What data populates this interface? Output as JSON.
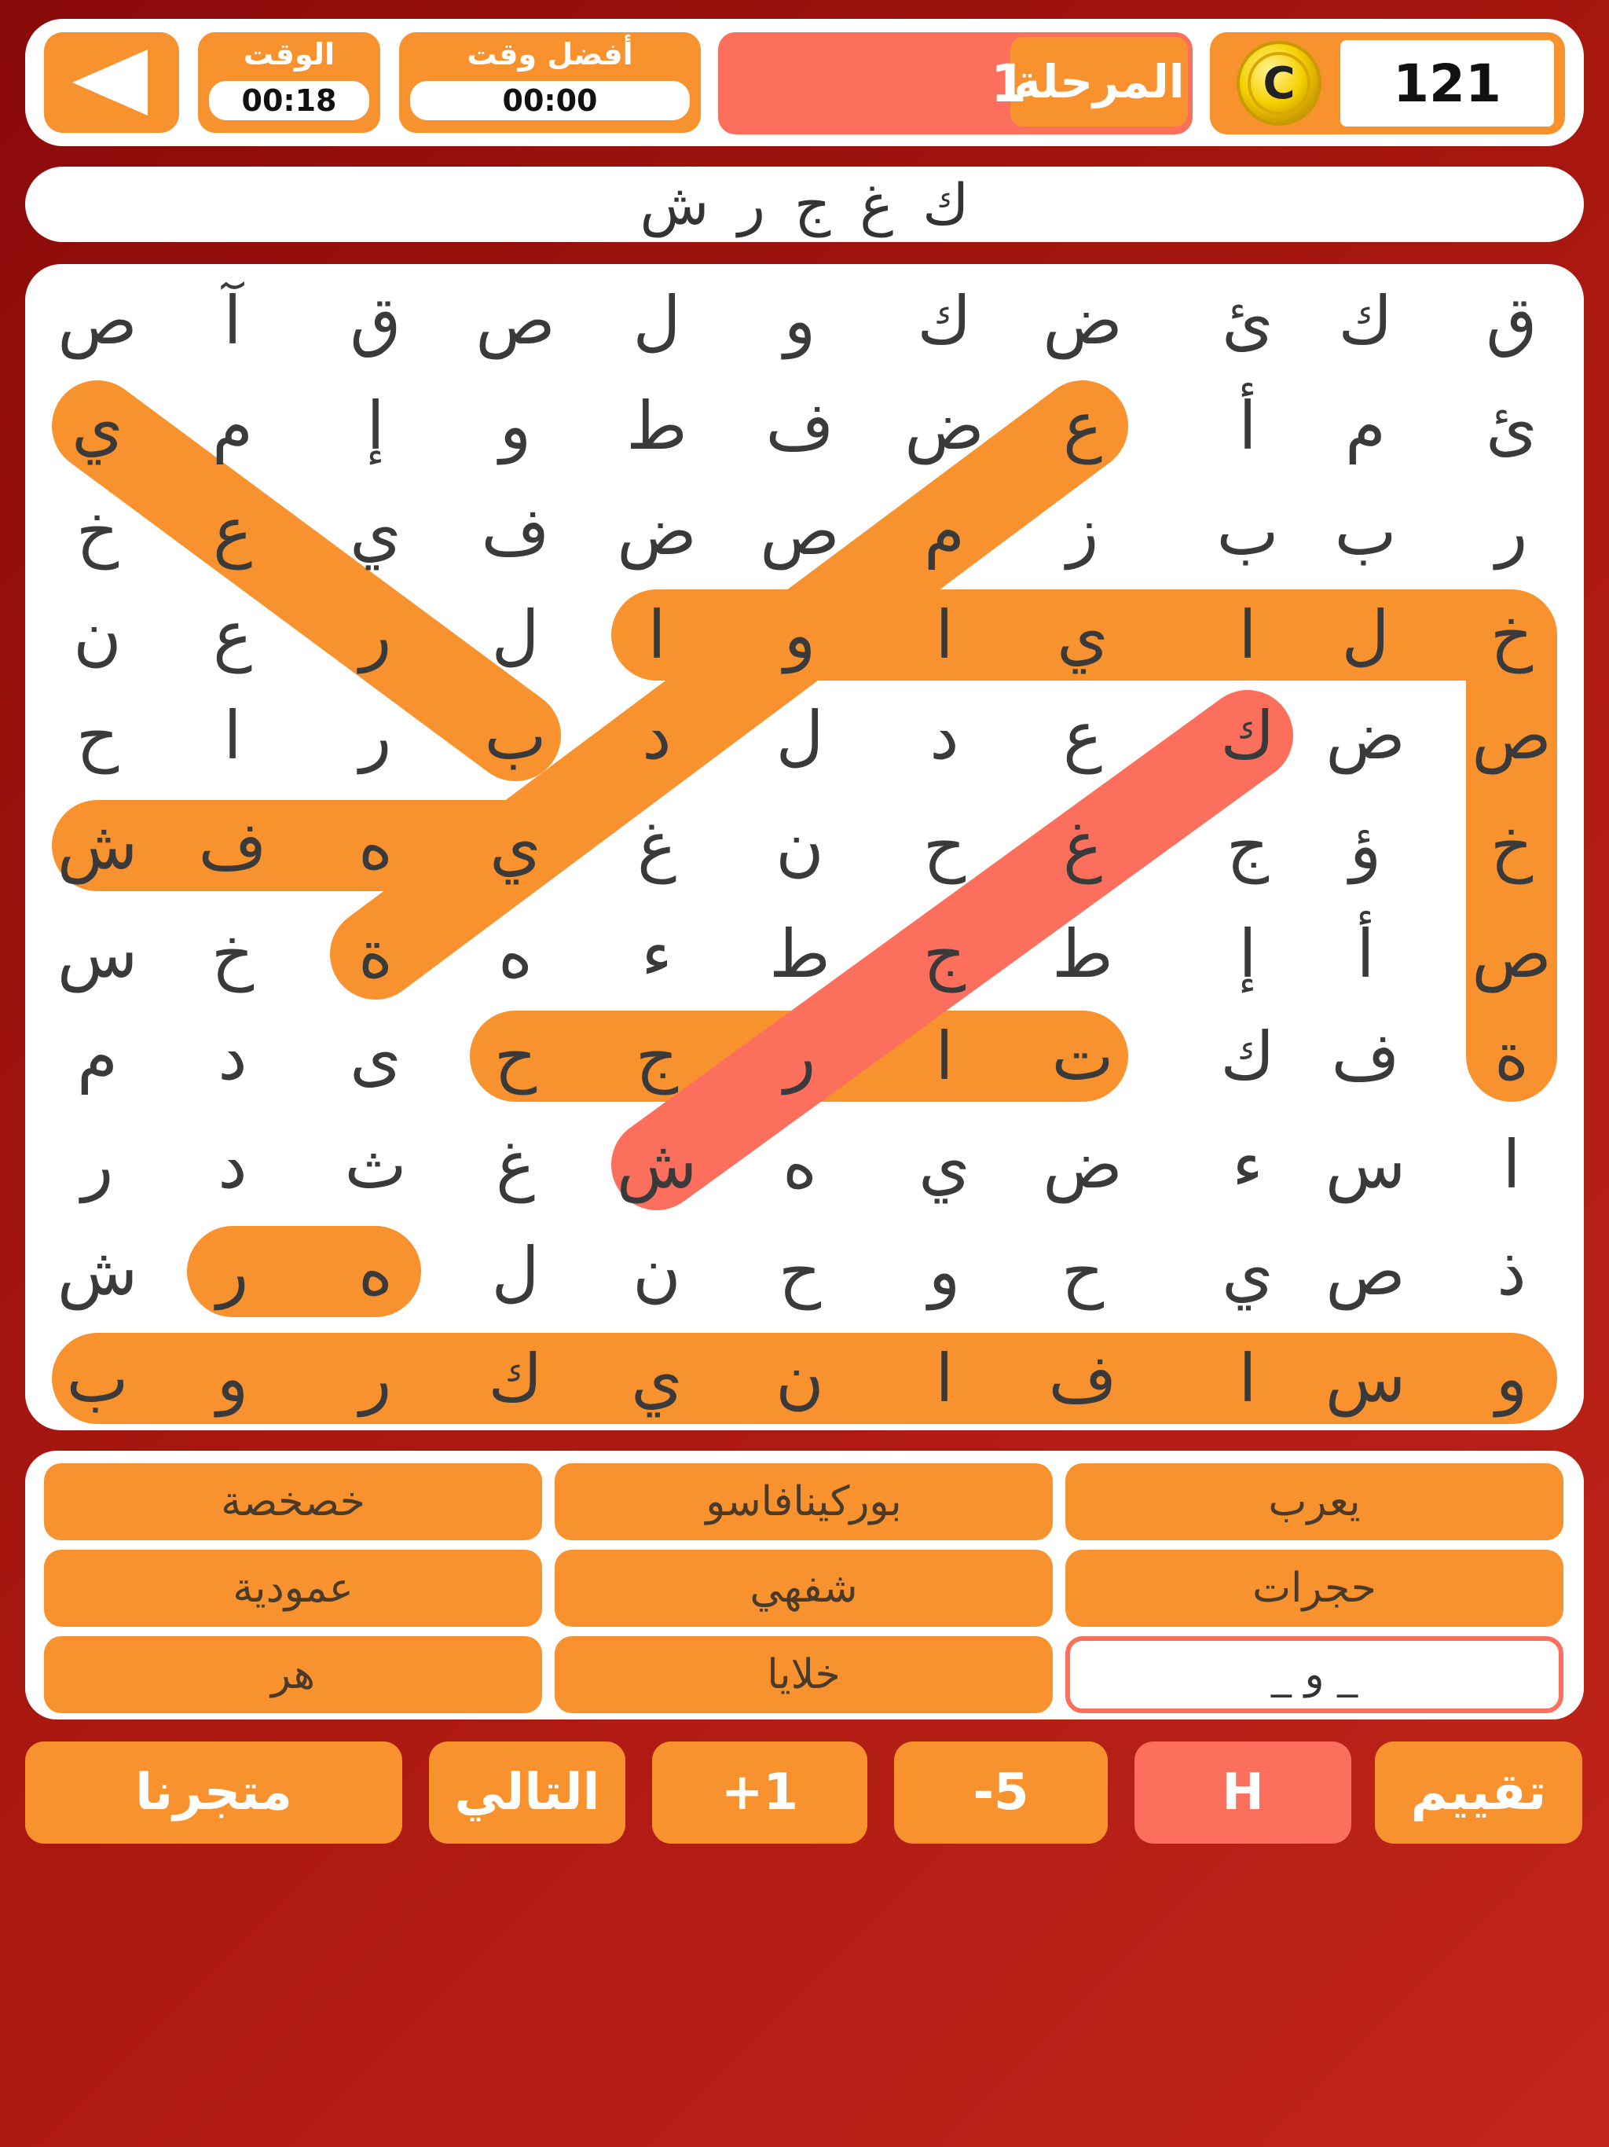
{
  "header": {
    "back_label": "back",
    "time_label": "الوقت",
    "time_value": "00:18",
    "best_time_label": "أفضل وقت",
    "best_time_value": "00:00",
    "stage_label": "المرحلة",
    "stage_value": "1",
    "coin_symbol": "C",
    "coins_value": "121"
  },
  "current_word": "ك غ ج ر ش",
  "grid": [
    [
      "ق",
      "ك",
      "ئ",
      "ض",
      "ك",
      "و",
      "ل",
      "ص",
      "ق",
      "آ",
      "ص"
    ],
    [
      "ئ",
      "م",
      "أ",
      "ع",
      "ض",
      "ف",
      "ط",
      "و",
      "إ",
      "م",
      "ي"
    ],
    [
      "ر",
      "ب",
      "ب",
      "ز",
      "م",
      "ص",
      "ض",
      "ف",
      "ي",
      "ع",
      "خ"
    ],
    [
      "خ",
      "ل",
      "ا",
      "ي",
      "ا",
      "و",
      "ا",
      "ل",
      "ر",
      "ع",
      "ن"
    ],
    [
      "ص",
      "ض",
      "ك",
      "ع",
      "د",
      "ل",
      "د",
      "ب",
      "ر",
      "ا",
      "ح"
    ],
    [
      "خ",
      "ؤ",
      "ج",
      "غ",
      "ح",
      "ن",
      "غ",
      "ي",
      "ه",
      "ف",
      "ش"
    ],
    [
      "ص",
      "أ",
      "إ",
      "ط",
      "ج",
      "ط",
      "ء",
      "ه",
      "ة",
      "خ",
      "س"
    ],
    [
      "ة",
      "ف",
      "ك",
      "ت",
      "ا",
      "ر",
      "ج",
      "ح",
      "ى",
      "د",
      "م"
    ],
    [
      "ا",
      "س",
      "ء",
      "ض",
      "ي",
      "ه",
      "ش",
      "غ",
      "ث",
      "د",
      "ر"
    ],
    [
      "ذ",
      "ص",
      "ي",
      "ح",
      "و",
      "ح",
      "ن",
      "ل",
      "ه",
      "ر",
      "ش"
    ],
    [
      "و",
      "س",
      "ا",
      "ف",
      "ا",
      "ن",
      "ي",
      "ك",
      "ر",
      "و",
      "ب"
    ]
  ],
  "words": [
    "يعرب",
    "بوركينافاسو",
    "خصخصة",
    "حجرات",
    "شفهي",
    "عمودية",
    "_ و _",
    "خلايا",
    "هر"
  ],
  "toolbar": {
    "rate": "تقييم",
    "hint": "H",
    "minus5": "-5",
    "plus1": "+1",
    "next": "التالي",
    "store": "متجرنا"
  },
  "colors": {
    "found": "#f7922f",
    "current": "#fc6f5c",
    "background": "#a5160f"
  }
}
